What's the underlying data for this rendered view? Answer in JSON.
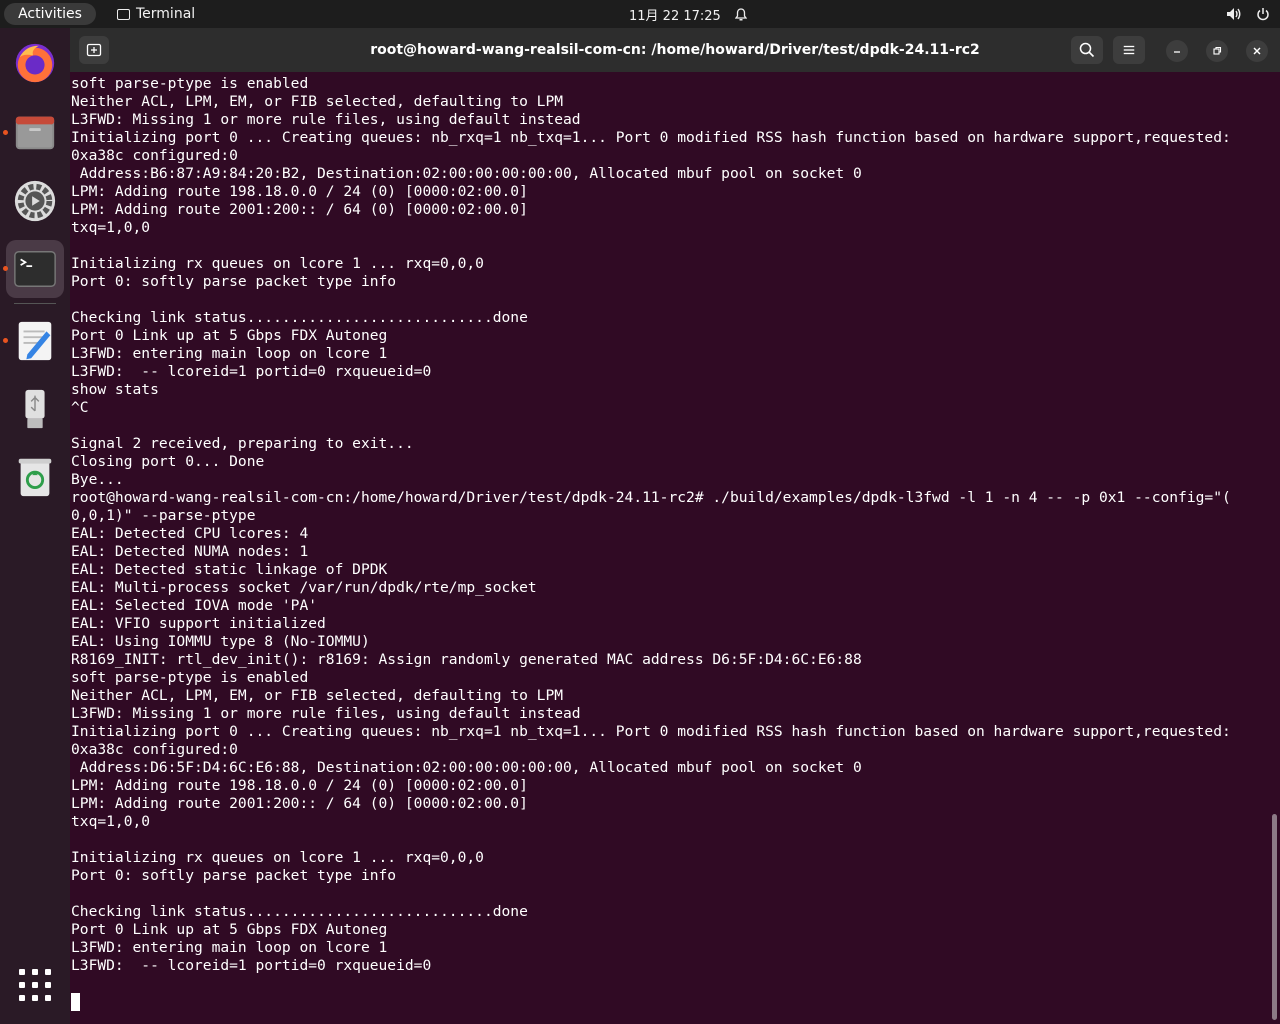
{
  "topbar": {
    "activities": "Activities",
    "app_name": "Terminal",
    "clock": "11月 22  17:25"
  },
  "dock": {
    "items": [
      "firefox-icon",
      "files-icon",
      "settings-icon",
      "terminal-icon",
      "text-editor-icon",
      "usb-drive-icon",
      "trash-icon"
    ]
  },
  "window": {
    "title": "root@howard-wang-realsil-com-cn: /home/howard/Driver/test/dpdk-24.11-rc2"
  },
  "terminal": {
    "lines": [
      "soft parse-ptype is enabled",
      "Neither ACL, LPM, EM, or FIB selected, defaulting to LPM",
      "L3FWD: Missing 1 or more rule files, using default instead",
      "Initializing port 0 ... Creating queues: nb_rxq=1 nb_txq=1... Port 0 modified RSS hash function based on hardware support,requested:",
      "0xa38c configured:0",
      " Address:B6:87:A9:84:20:B2, Destination:02:00:00:00:00:00, Allocated mbuf pool on socket 0",
      "LPM: Adding route 198.18.0.0 / 24 (0) [0000:02:00.0]",
      "LPM: Adding route 2001:200:: / 64 (0) [0000:02:00.0]",
      "txq=1,0,0",
      "",
      "Initializing rx queues on lcore 1 ... rxq=0,0,0",
      "Port 0: softly parse packet type info",
      "",
      "Checking link status............................done",
      "Port 0 Link up at 5 Gbps FDX Autoneg",
      "L3FWD: entering main loop on lcore 1",
      "L3FWD:  -- lcoreid=1 portid=0 rxqueueid=0",
      "show stats",
      "^C",
      "",
      "Signal 2 received, preparing to exit...",
      "Closing port 0... Done",
      "Bye...",
      "root@howard-wang-realsil-com-cn:/home/howard/Driver/test/dpdk-24.11-rc2# ./build/examples/dpdk-l3fwd -l 1 -n 4 -- -p 0x1 --config=\"(",
      "0,0,1)\" --parse-ptype",
      "EAL: Detected CPU lcores: 4",
      "EAL: Detected NUMA nodes: 1",
      "EAL: Detected static linkage of DPDK",
      "EAL: Multi-process socket /var/run/dpdk/rte/mp_socket",
      "EAL: Selected IOVA mode 'PA'",
      "EAL: VFIO support initialized",
      "EAL: Using IOMMU type 8 (No-IOMMU)",
      "R8169_INIT: rtl_dev_init(): r8169: Assign randomly generated MAC address D6:5F:D4:6C:E6:88",
      "soft parse-ptype is enabled",
      "Neither ACL, LPM, EM, or FIB selected, defaulting to LPM",
      "L3FWD: Missing 1 or more rule files, using default instead",
      "Initializing port 0 ... Creating queues: nb_rxq=1 nb_txq=1... Port 0 modified RSS hash function based on hardware support,requested:",
      "0xa38c configured:0",
      " Address:D6:5F:D4:6C:E6:88, Destination:02:00:00:00:00:00, Allocated mbuf pool on socket 0",
      "LPM: Adding route 198.18.0.0 / 24 (0) [0000:02:00.0]",
      "LPM: Adding route 2001:200:: / 64 (0) [0000:02:00.0]",
      "txq=1,0,0",
      "",
      "Initializing rx queues on lcore 1 ... rxq=0,0,0",
      "Port 0: softly parse packet type info",
      "",
      "Checking link status............................done",
      "Port 0 Link up at 5 Gbps FDX Autoneg",
      "L3FWD: entering main loop on lcore 1",
      "L3FWD:  -- lcoreid=1 portid=0 rxqueueid=0"
    ]
  },
  "colors": {
    "terminal_bg": "#300a24",
    "accent": "#e95420"
  }
}
